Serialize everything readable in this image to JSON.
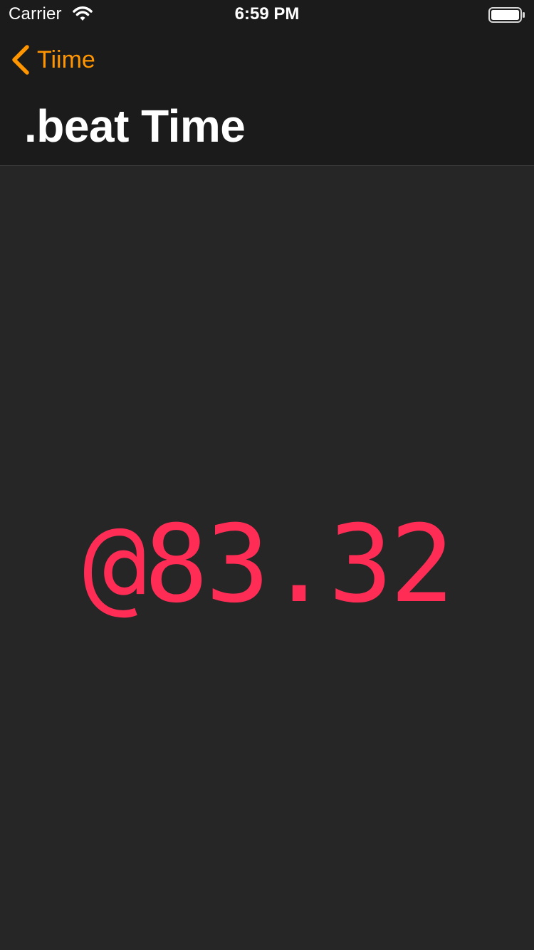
{
  "status_bar": {
    "carrier": "Carrier",
    "time": "6:59 PM",
    "icons": {
      "wifi": "wifi-icon",
      "battery": "battery-icon"
    }
  },
  "navigation": {
    "back_label": "Tiime",
    "title": ".beat Time",
    "back_icon": "chevron-left-icon"
  },
  "display": {
    "beat_time": "@83.32"
  },
  "colors": {
    "accent": "#ff9500",
    "beat_time": "#ff2d55",
    "background": "#262626",
    "navigation_background": "#1b1b1b",
    "text_primary": "#ffffff"
  }
}
